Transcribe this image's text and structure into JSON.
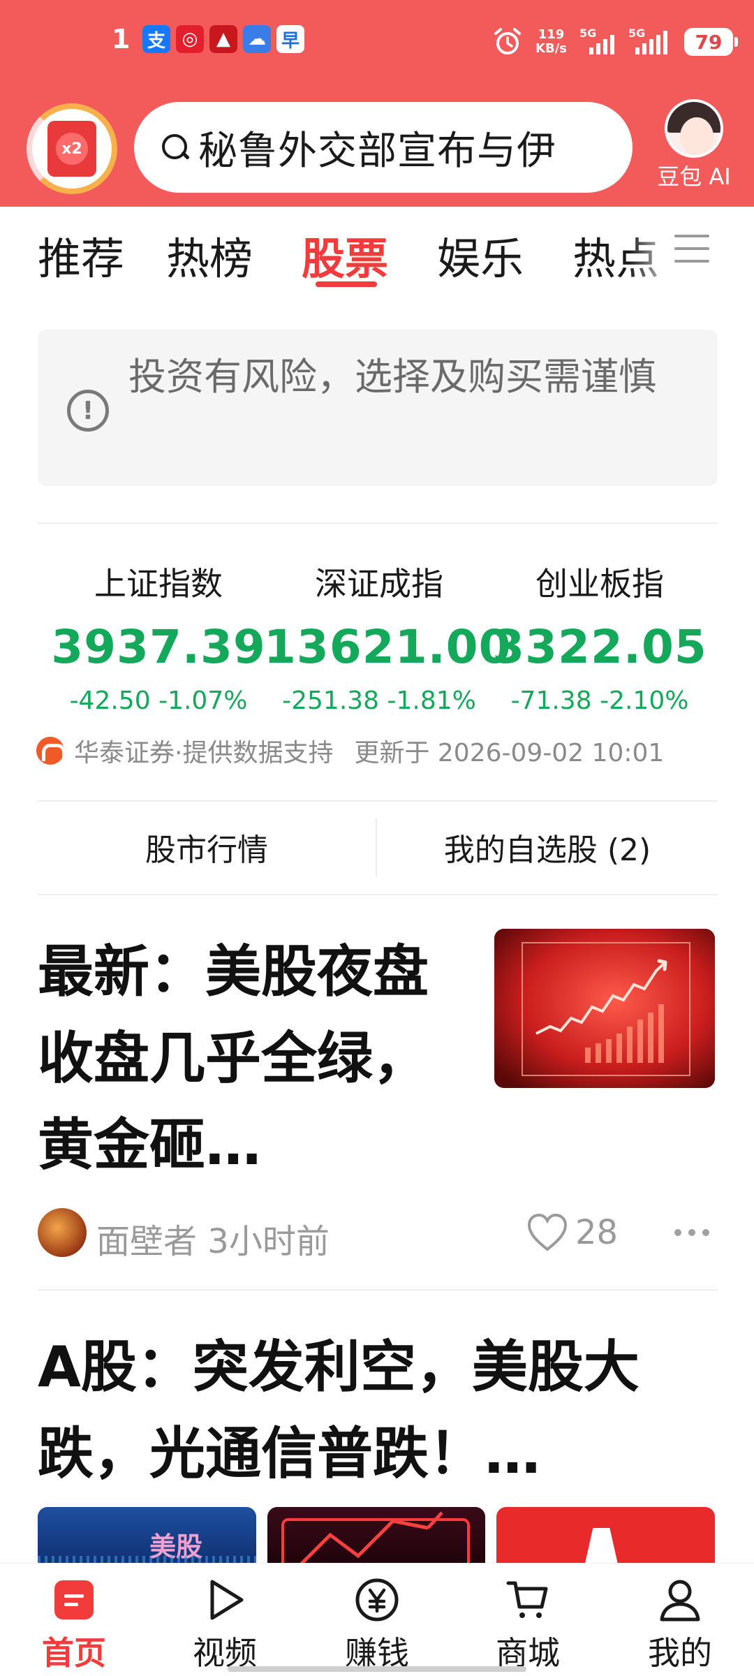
{
  "status_bar": {
    "time": "",
    "left_number": "1",
    "app_icons": [
      "alipay-icon",
      "netease-music-icon",
      "guoxin-securities-icon",
      "cloud-app-icon",
      "yueyue-app-icon"
    ],
    "network_speed": "119",
    "network_unit": "KB/s",
    "signal_1_label": "5G",
    "signal_2_label": "5G",
    "battery": "79"
  },
  "header": {
    "search_text": "秘鲁外交部宣布与伊",
    "redpacket_badge": "x2",
    "assistant_label": "豆包 AI"
  },
  "tabs": [
    "推荐",
    "热榜",
    "股票",
    "娱乐",
    "热点"
  ],
  "active_tab": "股票",
  "notice": {
    "text": "投资有风险，选择及购买需谨慎"
  },
  "indices": [
    {
      "name": "上证指数",
      "value": "3937.39",
      "change": "-42.50",
      "percent": "-1.07%"
    },
    {
      "name": "深证成指",
      "value": "13621.00",
      "change": "-251.38",
      "percent": "-1.81%"
    },
    {
      "name": "创业板指",
      "value": "3322.05",
      "change": "-71.38",
      "percent": "-2.10%"
    }
  ],
  "provider": {
    "text": "华泰证券·提供数据支持",
    "updated": "更新于 2026-09-02 10:01"
  },
  "links": {
    "market": "股市行情",
    "watchlist": "我的自选股 (2)"
  },
  "articles": [
    {
      "title": "最新：美股夜盘收盘几乎全绿，黄金砸…",
      "author": "面壁者",
      "time": "3小时前",
      "likes": "28"
    },
    {
      "title": "A股：突发利空，美股大跌，光通信普跌！…",
      "image_caption": "美股"
    }
  ],
  "bottom_nav": [
    {
      "label": "首页",
      "icon": "home-icon"
    },
    {
      "label": "视频",
      "icon": "play-icon"
    },
    {
      "label": "赚钱",
      "icon": "yuan-icon"
    },
    {
      "label": "商城",
      "icon": "cart-icon"
    },
    {
      "label": "我的",
      "icon": "user-icon"
    }
  ],
  "colors": {
    "header_red": "#f35a5a",
    "accent_red": "#f23b3b",
    "stock_green": "#14a85a"
  }
}
